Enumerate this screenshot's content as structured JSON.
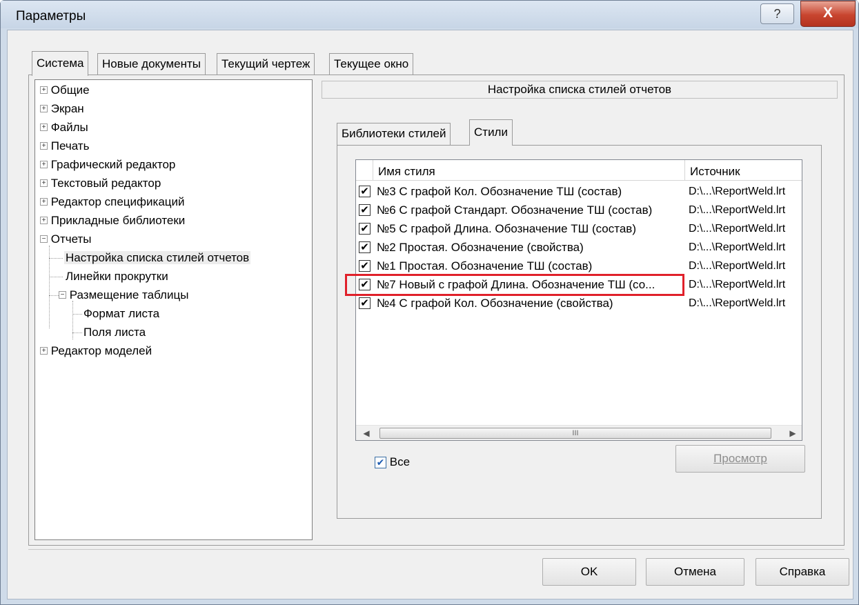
{
  "window": {
    "title": "Параметры",
    "help_glyph": "?",
    "close_glyph": "X"
  },
  "main_tabs": [
    {
      "label": "Система",
      "active": true
    },
    {
      "label": "Новые документы",
      "active": false
    },
    {
      "label": "Текущий чертеж",
      "active": false
    },
    {
      "label": "Текущее окно",
      "active": false
    }
  ],
  "tree": {
    "items": [
      {
        "label": "Общие"
      },
      {
        "label": "Экран"
      },
      {
        "label": "Файлы"
      },
      {
        "label": "Печать"
      },
      {
        "label": "Графический редактор"
      },
      {
        "label": "Текстовый редактор"
      },
      {
        "label": "Редактор спецификаций"
      },
      {
        "label": "Прикладные библиотеки"
      },
      {
        "label": "Отчеты"
      },
      {
        "label": "Настройка списка стилей отчетов"
      },
      {
        "label": "Линейки прокрутки"
      },
      {
        "label": "Размещение таблицы"
      },
      {
        "label": "Формат листа"
      },
      {
        "label": "Поля листа"
      },
      {
        "label": "Редактор моделей"
      }
    ]
  },
  "section": {
    "header": "Настройка списка стилей отчетов",
    "tabs": [
      {
        "label": "Библиотеки стилей",
        "active": false
      },
      {
        "label": "Стили",
        "active": true
      }
    ],
    "columns": {
      "name": "Имя стиля",
      "source": "Источник"
    },
    "rows": [
      {
        "name": "№3 С графой Кол. Обозначение ТШ (состав)",
        "source": "D:\\...\\ReportWeld.lrt",
        "checked": true
      },
      {
        "name": "№6 С графой Стандарт. Обозначение ТШ (состав)",
        "source": "D:\\...\\ReportWeld.lrt",
        "checked": true
      },
      {
        "name": "№5 С графой Длина. Обозначение ТШ (состав)",
        "source": "D:\\...\\ReportWeld.lrt",
        "checked": true
      },
      {
        "name": "№2 Простая. Обозначение (свойства)",
        "source": "D:\\...\\ReportWeld.lrt",
        "checked": true
      },
      {
        "name": "№1 Простая. Обозначение ТШ (состав)",
        "source": "D:\\...\\ReportWeld.lrt",
        "checked": true
      },
      {
        "name": "№7 Новый с графой Длина. Обозначение ТШ (со...",
        "source": "D:\\...\\ReportWeld.lrt",
        "checked": true
      },
      {
        "name": "№4 С графой Кол. Обозначение (свойства)",
        "source": "D:\\...\\ReportWeld.lrt",
        "checked": true
      }
    ],
    "check_glyph": "✔",
    "scroll_thumb_grip": "III",
    "all_label": "Все",
    "preview_button": "Просмотр"
  },
  "buttons": {
    "ok": "OK",
    "cancel": "Отмена",
    "help": "Справка"
  }
}
